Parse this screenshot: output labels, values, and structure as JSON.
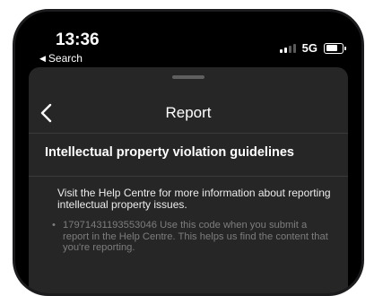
{
  "status_bar": {
    "time": "13:36",
    "back_label": "Search",
    "network": "5G"
  },
  "sheet": {
    "title": "Report",
    "heading": "Intellectual property violation guidelines",
    "info_text": "Visit the Help Centre for more information about reporting intellectual property issues.",
    "bullet_code": "17971431193553046",
    "bullet_text": "Use this code when you submit a report in the Help Centre. This helps us find the content that you're reporting."
  },
  "colors": {
    "background": "#000000",
    "sheet": "#262626",
    "text_primary": "#ffffff",
    "text_muted": "#7d7d7d"
  }
}
